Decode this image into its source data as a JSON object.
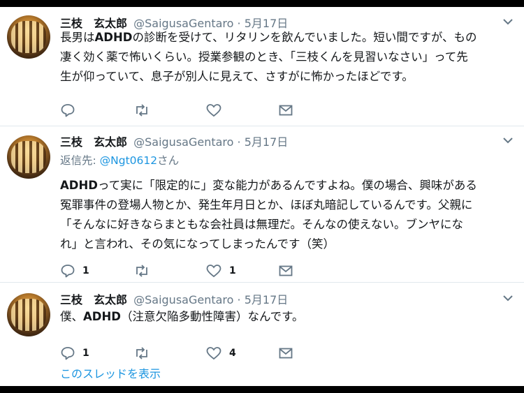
{
  "tweets": [
    {
      "name": "三枝　玄太郎",
      "handle": "@SaigusaGentaro",
      "date": "· 5月17日",
      "lines": [
        [
          "長男は",
          "ADHD",
          "の診断を受けて、リタリンを飲んでいました。短い間ですが、もの"
        ],
        [
          "凄く効く薬で怖いくらい。授業参観のとき、「三枝くんを見習いなさい」って先"
        ],
        [
          "生が仰っていて、息子が別人に見えて、さすがに怖かったほどです。"
        ]
      ],
      "reply_count": "",
      "retweet_count": "",
      "like_count": ""
    },
    {
      "name": "三枝　玄太郎",
      "handle": "@SaigusaGentaro",
      "date": "· 5月17日",
      "reply_prefix": "返信先: ",
      "reply_mention": "@Ngt0612",
      "reply_suffix": "さん",
      "lines": [
        [
          "",
          "ADHD",
          "って実に「限定的に」変な能力があるんですよね。僕の場合、興味がある"
        ],
        [
          "冤罪事件の登場人物とか、発生年月日とか、ほぼ丸暗記しているんです。父親に"
        ],
        [
          "「そんなに好きならまともな会社員は無理だ。そんなの使えない。ブンヤにな"
        ],
        [
          "れ」と言われ、その気になってしまったんです（笑）"
        ]
      ],
      "reply_count": "1",
      "retweet_count": "",
      "like_count": "1"
    },
    {
      "name": "三枝　玄太郎",
      "handle": "@SaigusaGentaro",
      "date": "· 5月17日",
      "lines": [
        [
          "僕、",
          "ADHD",
          "（注意欠陥多動性障害）なんです。"
        ]
      ],
      "reply_count": "1",
      "retweet_count": "",
      "like_count": "4"
    }
  ],
  "thread_link": "このスレッドを表示",
  "colors": {
    "link": "#1b95e0",
    "muted": "#657786",
    "text": "#14171a"
  }
}
